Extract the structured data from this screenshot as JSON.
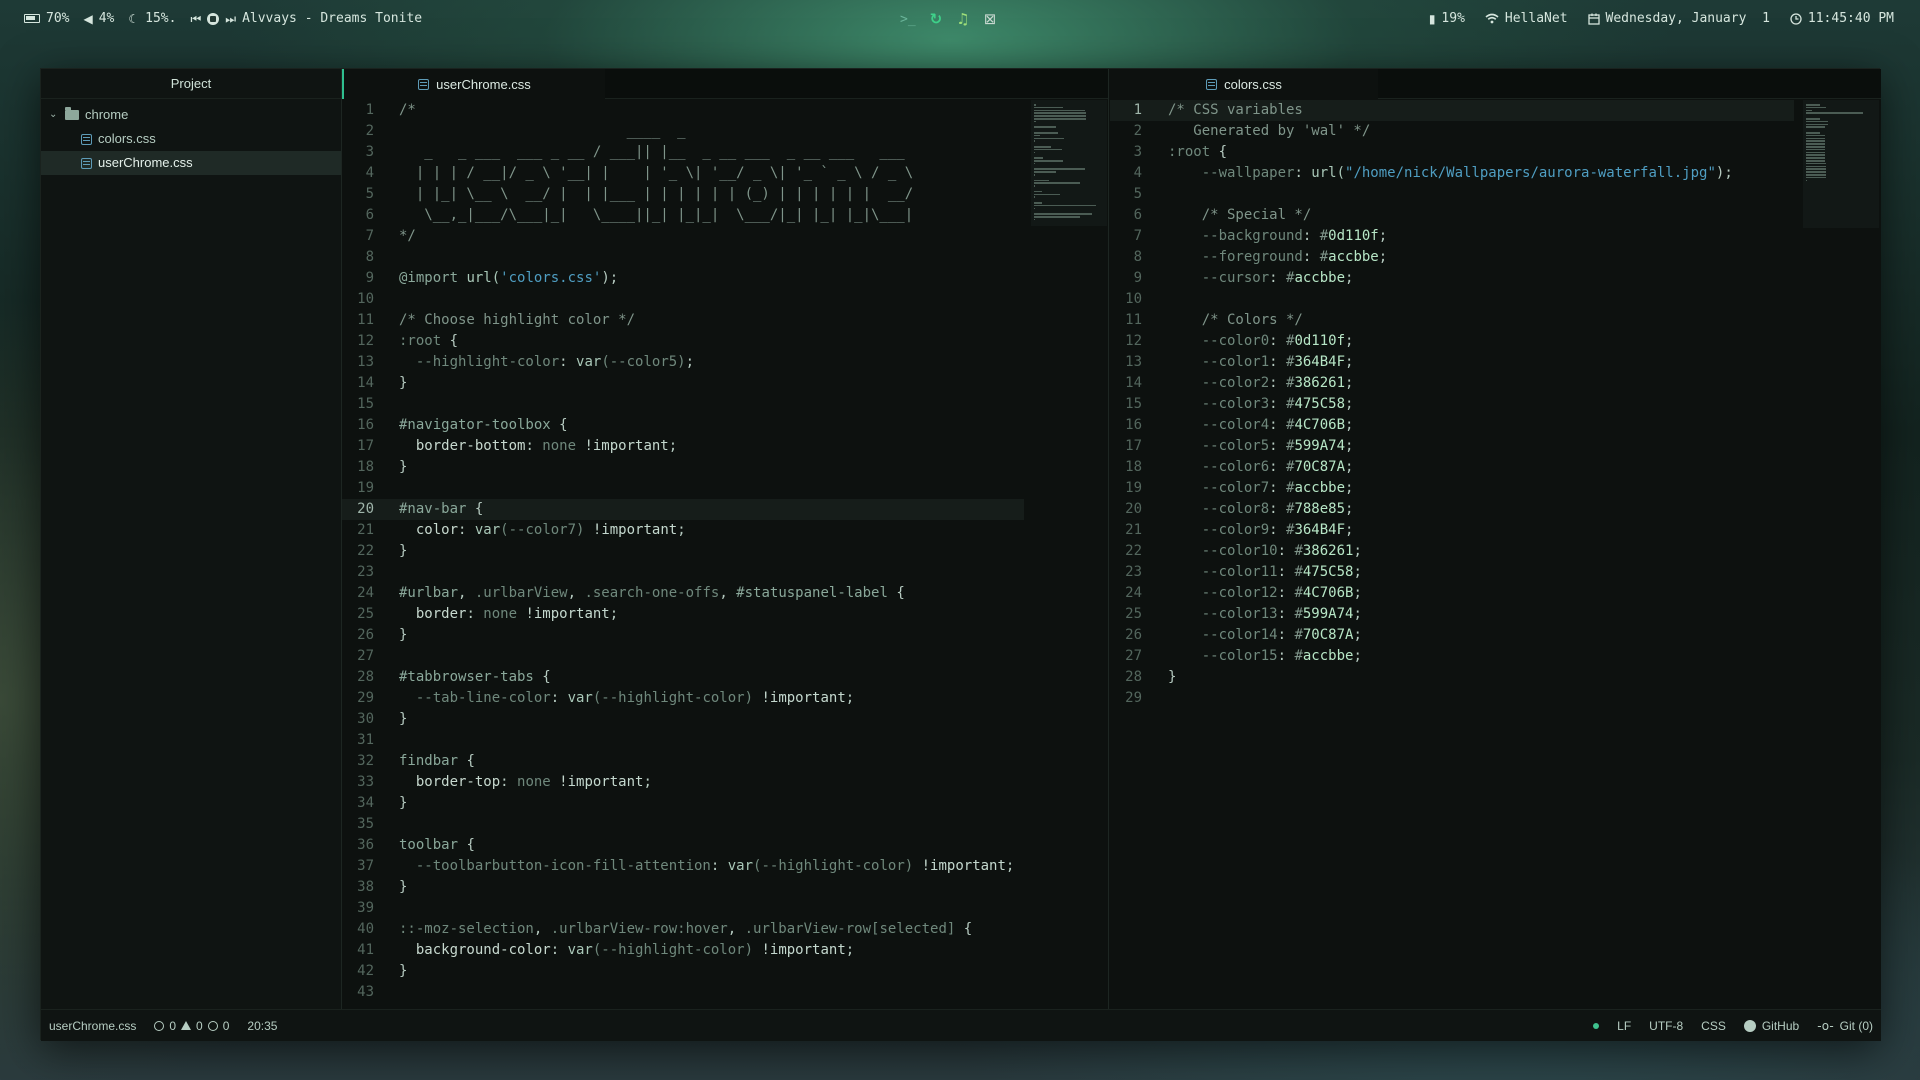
{
  "topbar": {
    "battery": "70%",
    "volume": "4%",
    "brightness": "15%.",
    "now_playing": "Alvvays - Dreams Tonite",
    "center_icons": [
      "terminal-icon",
      "refresh-icon",
      "music-icon",
      "close-box-icon"
    ],
    "center_terminal_glyph": ">_",
    "center_refresh_glyph": "↻",
    "center_music_glyph": "♫",
    "center_close_glyph": "⊠",
    "phone_battery": "19%",
    "wifi": "HellaNet",
    "date": "Wednesday, January  1",
    "time": "11:45:40 PM"
  },
  "sidebar": {
    "title": "Project",
    "folder": "chrome",
    "files": [
      {
        "label": "colors.css",
        "selected": false
      },
      {
        "label": "userChrome.css",
        "selected": true
      }
    ]
  },
  "left_pane": {
    "tab_label": "userChrome.css",
    "active_line": 20,
    "lines": [
      [
        [
          "/*",
          "com"
        ]
      ],
      [
        [
          "                           ____  _",
          "com"
        ]
      ],
      [
        [
          "   _   _ ___  ___ _ __ / ___|| |__  _ __ ___  _ __ ___   ___",
          "com"
        ]
      ],
      [
        [
          "  | | | / __|/ _ \\ '__| |    | '_ \\| '__/ _ \\| '_ ` _ \\ / _ \\",
          "com"
        ]
      ],
      [
        [
          "  | |_| \\__ \\  __/ |  | |___ | | | | | | (_) | | | | | |  __/",
          "com"
        ]
      ],
      [
        [
          "   \\__,_|___/\\___|_|   \\____||_| |_|_|  \\___/|_| |_| |_|\\___|",
          "com"
        ]
      ],
      [
        [
          "*/",
          "com"
        ]
      ],
      [],
      [
        [
          "@import",
          "sel"
        ],
        [
          " url(",
          "fn"
        ],
        [
          "'colors.css'",
          "str"
        ],
        [
          ");",
          "punc"
        ]
      ],
      [],
      [
        [
          "/* Choose highlight color */",
          "com"
        ]
      ],
      [
        [
          ":root",
          "dim"
        ],
        [
          " {",
          "punc"
        ]
      ],
      [
        [
          "  --highlight-color",
          "dim"
        ],
        [
          ": ",
          "punc"
        ],
        [
          "var",
          "fn"
        ],
        [
          "(--color5)",
          "dim"
        ],
        [
          ";",
          "punc"
        ]
      ],
      [
        [
          "}",
          "punc"
        ]
      ],
      [],
      [
        [
          "#navigator-toolbox",
          "sel"
        ],
        [
          " {",
          "punc"
        ]
      ],
      [
        [
          "  border-bottom",
          "prop"
        ],
        [
          ": ",
          "punc"
        ],
        [
          "none",
          "dim"
        ],
        [
          " !important",
          "imp"
        ],
        [
          ";",
          "punc"
        ]
      ],
      [
        [
          "}",
          "punc"
        ]
      ],
      [],
      [
        [
          "#nav-bar",
          "sel"
        ],
        [
          " {",
          "punc"
        ]
      ],
      [
        [
          "  color",
          "prop"
        ],
        [
          ": ",
          "punc"
        ],
        [
          "var",
          "fn"
        ],
        [
          "(--color7)",
          "dim"
        ],
        [
          " !important",
          "imp"
        ],
        [
          ";",
          "punc"
        ]
      ],
      [
        [
          "}",
          "punc"
        ]
      ],
      [],
      [
        [
          "#urlbar",
          "sel"
        ],
        [
          ", ",
          "punc"
        ],
        [
          ".urlbarView",
          "dim"
        ],
        [
          ", ",
          "punc"
        ],
        [
          ".search-one-offs",
          "dim"
        ],
        [
          ", ",
          "punc"
        ],
        [
          "#statuspanel-label",
          "sel"
        ],
        [
          " {",
          "punc"
        ]
      ],
      [
        [
          "  border",
          "prop"
        ],
        [
          ": ",
          "punc"
        ],
        [
          "none",
          "dim"
        ],
        [
          " !important",
          "imp"
        ],
        [
          ";",
          "punc"
        ]
      ],
      [
        [
          "}",
          "punc"
        ]
      ],
      [],
      [
        [
          "#tabbrowser-tabs",
          "sel"
        ],
        [
          " {",
          "punc"
        ]
      ],
      [
        [
          "  --tab-line-color",
          "dim"
        ],
        [
          ": ",
          "punc"
        ],
        [
          "var",
          "fn"
        ],
        [
          "(--highlight-color)",
          "dim"
        ],
        [
          " !important",
          "imp"
        ],
        [
          ";",
          "punc"
        ]
      ],
      [
        [
          "}",
          "punc"
        ]
      ],
      [],
      [
        [
          "findbar",
          "sel"
        ],
        [
          " {",
          "punc"
        ]
      ],
      [
        [
          "  border-top",
          "prop"
        ],
        [
          ": ",
          "punc"
        ],
        [
          "none",
          "dim"
        ],
        [
          " !important",
          "imp"
        ],
        [
          ";",
          "punc"
        ]
      ],
      [
        [
          "}",
          "punc"
        ]
      ],
      [],
      [
        [
          "toolbar",
          "sel"
        ],
        [
          " {",
          "punc"
        ]
      ],
      [
        [
          "  --toolbarbutton-icon-fill-attention",
          "dim"
        ],
        [
          ": ",
          "punc"
        ],
        [
          "var",
          "fn"
        ],
        [
          "(--highlight-color)",
          "dim"
        ],
        [
          " !important",
          "imp"
        ],
        [
          ";",
          "punc"
        ]
      ],
      [
        [
          "}",
          "punc"
        ]
      ],
      [],
      [
        [
          "::-moz-selection",
          "dim"
        ],
        [
          ", ",
          "punc"
        ],
        [
          ".urlbarView-row:hover",
          "dim"
        ],
        [
          ", ",
          "punc"
        ],
        [
          ".urlbarView-row",
          "dim"
        ],
        [
          "[selected]",
          "dim"
        ],
        [
          " {",
          "punc"
        ]
      ],
      [
        [
          "  background-color",
          "prop"
        ],
        [
          ": ",
          "punc"
        ],
        [
          "var",
          "fn"
        ],
        [
          "(--highlight-color)",
          "dim"
        ],
        [
          " !important",
          "imp"
        ],
        [
          ";",
          "punc"
        ]
      ],
      [
        [
          "}",
          "punc"
        ]
      ],
      []
    ]
  },
  "right_pane": {
    "tab_label": "colors.css",
    "active_line": 1,
    "lines": [
      [
        [
          "/* CSS variables",
          "com"
        ]
      ],
      [
        [
          "   Generated by 'wal' */",
          "com"
        ]
      ],
      [
        [
          ":root",
          "dim"
        ],
        [
          " {",
          "punc"
        ]
      ],
      [
        [
          "    --wallpaper",
          "dim"
        ],
        [
          ": ",
          "punc"
        ],
        [
          "url(",
          "fn"
        ],
        [
          "\"/home/nick/Wallpapers/aurora-waterfall.jpg\"",
          "str"
        ],
        [
          ");",
          "punc"
        ]
      ],
      [],
      [
        [
          "    /* Special */",
          "com"
        ]
      ],
      [
        [
          "    --background",
          "dim"
        ],
        [
          ": ",
          "punc"
        ],
        [
          "#",
          "hash"
        ],
        [
          "0d110f",
          "hex"
        ],
        [
          ";",
          "punc"
        ]
      ],
      [
        [
          "    --foreground",
          "dim"
        ],
        [
          ": ",
          "punc"
        ],
        [
          "#",
          "hash"
        ],
        [
          "accbbe",
          "hex"
        ],
        [
          ";",
          "punc"
        ]
      ],
      [
        [
          "    --cursor",
          "dim"
        ],
        [
          ": ",
          "punc"
        ],
        [
          "#",
          "hash"
        ],
        [
          "accbbe",
          "hex"
        ],
        [
          ";",
          "punc"
        ]
      ],
      [],
      [
        [
          "    /* Colors */",
          "com"
        ]
      ],
      [
        [
          "    --color0",
          "dim"
        ],
        [
          ": ",
          "punc"
        ],
        [
          "#",
          "hash"
        ],
        [
          "0d110f",
          "hex"
        ],
        [
          ";",
          "punc"
        ]
      ],
      [
        [
          "    --color1",
          "dim"
        ],
        [
          ": ",
          "punc"
        ],
        [
          "#",
          "hash"
        ],
        [
          "364B4F",
          "hex"
        ],
        [
          ";",
          "punc"
        ]
      ],
      [
        [
          "    --color2",
          "dim"
        ],
        [
          ": ",
          "punc"
        ],
        [
          "#",
          "hash"
        ],
        [
          "386261",
          "hex"
        ],
        [
          ";",
          "punc"
        ]
      ],
      [
        [
          "    --color3",
          "dim"
        ],
        [
          ": ",
          "punc"
        ],
        [
          "#",
          "hash"
        ],
        [
          "475C58",
          "hex"
        ],
        [
          ";",
          "punc"
        ]
      ],
      [
        [
          "    --color4",
          "dim"
        ],
        [
          ": ",
          "punc"
        ],
        [
          "#",
          "hash"
        ],
        [
          "4C706B",
          "hex"
        ],
        [
          ";",
          "punc"
        ]
      ],
      [
        [
          "    --color5",
          "dim"
        ],
        [
          ": ",
          "punc"
        ],
        [
          "#",
          "hash"
        ],
        [
          "599A74",
          "hex"
        ],
        [
          ";",
          "punc"
        ]
      ],
      [
        [
          "    --color6",
          "dim"
        ],
        [
          ": ",
          "punc"
        ],
        [
          "#",
          "hash"
        ],
        [
          "70C87A",
          "hex"
        ],
        [
          ";",
          "punc"
        ]
      ],
      [
        [
          "    --color7",
          "dim"
        ],
        [
          ": ",
          "punc"
        ],
        [
          "#",
          "hash"
        ],
        [
          "accbbe",
          "hex"
        ],
        [
          ";",
          "punc"
        ]
      ],
      [
        [
          "    --color8",
          "dim"
        ],
        [
          ": ",
          "punc"
        ],
        [
          "#",
          "hash"
        ],
        [
          "788e85",
          "hex"
        ],
        [
          ";",
          "punc"
        ]
      ],
      [
        [
          "    --color9",
          "dim"
        ],
        [
          ": ",
          "punc"
        ],
        [
          "#",
          "hash"
        ],
        [
          "364B4F",
          "hex"
        ],
        [
          ";",
          "punc"
        ]
      ],
      [
        [
          "    --color10",
          "dim"
        ],
        [
          ": ",
          "punc"
        ],
        [
          "#",
          "hash"
        ],
        [
          "386261",
          "hex"
        ],
        [
          ";",
          "punc"
        ]
      ],
      [
        [
          "    --color11",
          "dim"
        ],
        [
          ": ",
          "punc"
        ],
        [
          "#",
          "hash"
        ],
        [
          "475C58",
          "hex"
        ],
        [
          ";",
          "punc"
        ]
      ],
      [
        [
          "    --color12",
          "dim"
        ],
        [
          ": ",
          "punc"
        ],
        [
          "#",
          "hash"
        ],
        [
          "4C706B",
          "hex"
        ],
        [
          ";",
          "punc"
        ]
      ],
      [
        [
          "    --color13",
          "dim"
        ],
        [
          ": ",
          "punc"
        ],
        [
          "#",
          "hash"
        ],
        [
          "599A74",
          "hex"
        ],
        [
          ";",
          "punc"
        ]
      ],
      [
        [
          "    --color14",
          "dim"
        ],
        [
          ": ",
          "punc"
        ],
        [
          "#",
          "hash"
        ],
        [
          "70C87A",
          "hex"
        ],
        [
          ";",
          "punc"
        ]
      ],
      [
        [
          "    --color15",
          "dim"
        ],
        [
          ": ",
          "punc"
        ],
        [
          "#",
          "hash"
        ],
        [
          "accbbe",
          "hex"
        ],
        [
          ";",
          "punc"
        ]
      ],
      [
        [
          "}",
          "punc"
        ]
      ],
      []
    ]
  },
  "statusbar": {
    "file": "userChrome.css",
    "errors": "0",
    "warnings": "0",
    "infos": "0",
    "cursor": "20:35",
    "line_ending": "LF",
    "encoding": "UTF-8",
    "grammar": "CSS",
    "github": "GitHub",
    "git": "Git (0)"
  },
  "colors": {
    "background": "#0d110f",
    "foreground": "#accbbe",
    "accent": "#2fbf8f"
  }
}
